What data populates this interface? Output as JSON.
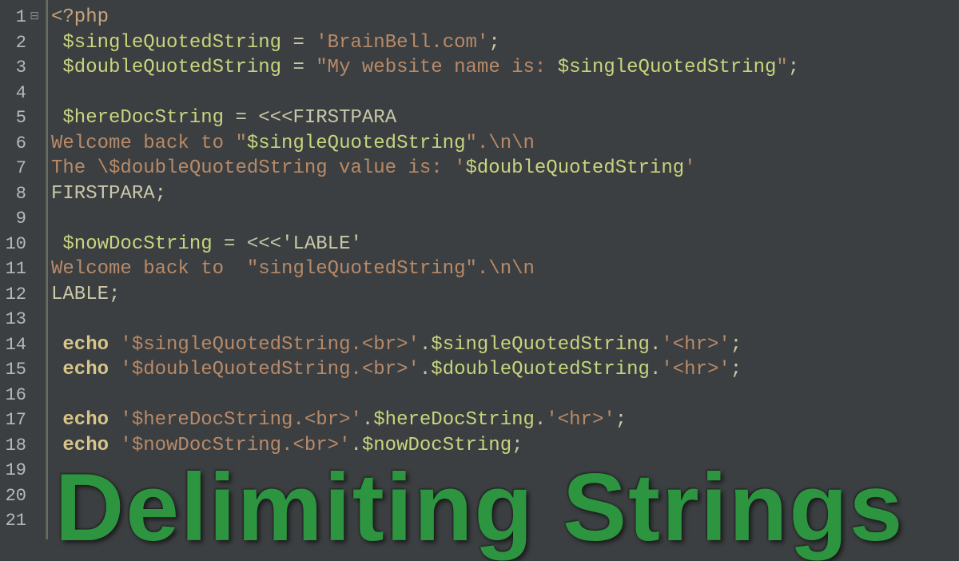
{
  "overlay": {
    "title": "Delimiting Strings"
  },
  "gutter": {
    "lines": [
      "1",
      "2",
      "3",
      "4",
      "5",
      "6",
      "7",
      "8",
      "9",
      "10",
      "11",
      "12",
      "13",
      "14",
      "15",
      "16",
      "17",
      "18",
      "19",
      "20",
      "21"
    ],
    "fold_line": 1,
    "fold_glyph": "⊟"
  },
  "code": {
    "lines": [
      {
        "seg": [
          {
            "t": "<?php",
            "c": "tag"
          }
        ]
      },
      {
        "indent": 1,
        "seg": [
          {
            "t": "$singleQuotedString",
            "c": "variable"
          },
          {
            "t": " = ",
            "c": "operator"
          },
          {
            "t": "'BrainBell.com'",
            "c": "string"
          },
          {
            "t": ";",
            "c": "punct"
          }
        ]
      },
      {
        "indent": 1,
        "seg": [
          {
            "t": "$doubleQuotedString",
            "c": "variable"
          },
          {
            "t": " = ",
            "c": "operator"
          },
          {
            "t": "\"My website name is: ",
            "c": "string"
          },
          {
            "t": "$singleQuotedString",
            "c": "string-var"
          },
          {
            "t": "\"",
            "c": "string"
          },
          {
            "t": ";",
            "c": "punct"
          }
        ]
      },
      {
        "seg": []
      },
      {
        "indent": 1,
        "seg": [
          {
            "t": "$hereDocString",
            "c": "variable"
          },
          {
            "t": " = ",
            "c": "operator"
          },
          {
            "t": "<<<FIRSTPARA",
            "c": "heredoc-label"
          }
        ]
      },
      {
        "seg": [
          {
            "t": "Welcome back to \"",
            "c": "string"
          },
          {
            "t": "$singleQuotedString",
            "c": "string-var"
          },
          {
            "t": "\".\\n\\n",
            "c": "string"
          }
        ]
      },
      {
        "seg": [
          {
            "t": "The \\$doubleQuotedString value is: '",
            "c": "string"
          },
          {
            "t": "$doubleQuotedString",
            "c": "string-var"
          },
          {
            "t": "'",
            "c": "string"
          }
        ]
      },
      {
        "seg": [
          {
            "t": "FIRSTPARA",
            "c": "heredoc-label"
          },
          {
            "t": ";",
            "c": "punct"
          }
        ]
      },
      {
        "seg": []
      },
      {
        "indent": 1,
        "seg": [
          {
            "t": "$nowDocString",
            "c": "variable"
          },
          {
            "t": " = ",
            "c": "operator"
          },
          {
            "t": "<<<'LABLE'",
            "c": "heredoc-label"
          }
        ]
      },
      {
        "seg": [
          {
            "t": "Welcome back to  \"singleQuotedString\".\\n\\n",
            "c": "string"
          }
        ]
      },
      {
        "seg": [
          {
            "t": "LABLE",
            "c": "heredoc-label"
          },
          {
            "t": ";",
            "c": "punct"
          }
        ]
      },
      {
        "seg": []
      },
      {
        "indent": 1,
        "seg": [
          {
            "t": "echo",
            "c": "keyword"
          },
          {
            "t": " ",
            "c": "plain"
          },
          {
            "t": "'$singleQuotedString.<br>'",
            "c": "string"
          },
          {
            "t": ".",
            "c": "operator"
          },
          {
            "t": "$singleQuotedString",
            "c": "variable"
          },
          {
            "t": ".",
            "c": "operator"
          },
          {
            "t": "'<hr>'",
            "c": "string"
          },
          {
            "t": ";",
            "c": "punct"
          }
        ]
      },
      {
        "indent": 1,
        "seg": [
          {
            "t": "echo",
            "c": "keyword"
          },
          {
            "t": " ",
            "c": "plain"
          },
          {
            "t": "'$doubleQuotedString.<br>'",
            "c": "string"
          },
          {
            "t": ".",
            "c": "operator"
          },
          {
            "t": "$doubleQuotedString",
            "c": "variable"
          },
          {
            "t": ".",
            "c": "operator"
          },
          {
            "t": "'<hr>'",
            "c": "string"
          },
          {
            "t": ";",
            "c": "punct"
          }
        ]
      },
      {
        "seg": []
      },
      {
        "indent": 1,
        "seg": [
          {
            "t": "echo",
            "c": "keyword"
          },
          {
            "t": " ",
            "c": "plain"
          },
          {
            "t": "'$hereDocString.<br>'",
            "c": "string"
          },
          {
            "t": ".",
            "c": "operator"
          },
          {
            "t": "$hereDocString",
            "c": "variable"
          },
          {
            "t": ".",
            "c": "operator"
          },
          {
            "t": "'<hr>'",
            "c": "string"
          },
          {
            "t": ";",
            "c": "punct"
          }
        ]
      },
      {
        "indent": 1,
        "seg": [
          {
            "t": "echo",
            "c": "keyword"
          },
          {
            "t": " ",
            "c": "plain"
          },
          {
            "t": "'$nowDocString.<br>'",
            "c": "string"
          },
          {
            "t": ".",
            "c": "operator"
          },
          {
            "t": "$nowDocString",
            "c": "variable"
          },
          {
            "t": ";",
            "c": "punct"
          }
        ]
      },
      {
        "seg": []
      },
      {
        "seg": []
      },
      {
        "seg": []
      }
    ]
  }
}
